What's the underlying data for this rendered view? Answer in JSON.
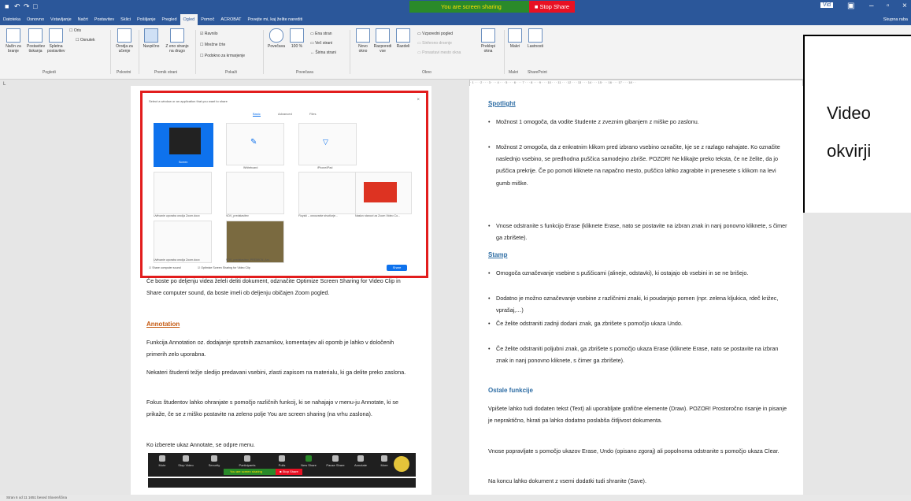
{
  "sharing": {
    "status": "You are screen sharing",
    "stop": "■ Stop Share"
  },
  "title": {
    "user": "Vid"
  },
  "tabs": [
    "Datoteka",
    "Osnovno",
    "Vstavljanje",
    "Načrt",
    "Postavitev",
    "Sklici",
    "Pošiljanje",
    "Pregled",
    "Ogled",
    "Pomoč",
    "ACROBAT",
    "Povejte mi, kaj želite narediti"
  ],
  "share_btn": "Skupna raba",
  "ribbon": {
    "buttons": [
      "Način za branje",
      "Postavitev tiskanja",
      "Spletna postavitev",
      "Orodja za učenje",
      "Navpično",
      "Z eno stranjo na drugo",
      "Povečava",
      "100 %",
      "Novo okno",
      "Razporedi vse",
      "Razdeli",
      "Preklopi okna",
      "Makri",
      "Lastnosti"
    ],
    "checks": [
      "Ravnilo",
      "Mrežne črte",
      "Podokno za krmarjenje",
      "Ena stran",
      "Več strani",
      "Širina strani",
      "Vzporedni pogled",
      "Sinhrono drsenje",
      "Ponastavi mesto okna",
      "Oris",
      "Osnutek"
    ],
    "groups": [
      "Pogledi",
      "Pokretni",
      "Premik strani",
      "Pokaži",
      "Povečava",
      "Okno",
      "Makri",
      "SharePoint"
    ]
  },
  "dialog": {
    "title": "Select a window or an application that you want to share",
    "tabs": [
      "Basic",
      "Advanced",
      "Files"
    ],
    "thumbs": [
      "Screen",
      "Whiteboard",
      "iPhone/iPad",
      "Uvfivanie uporaba orodja Zoom.docx",
      "VDV_predstavitev",
      "Fizyzki – osnovarke stvotlorje...",
      "Naslov stanovi za Zoom Video Co...",
      "Uvfivanie uporaba orodja Zoom.docx",
      "VDV_predstavitev_PREMICN_Aru..."
    ],
    "check1": "Share computer sound",
    "check2": "Optimize Screen Sharing for Video Clip",
    "share": "Share"
  },
  "page1": {
    "para1": "Če boste po deljenju videa želeli deliti dokument, odznačite Optimize Screen Sharing for Video Clip in Share computer sound, da boste imeli ob deljenju običajen Zoom pogled.",
    "h_annotation": "Annotation",
    "para2": "Funkcija Annotation oz. dodajanje sprotnih zaznamkov, komentarjev ali opomb je lahko v določenih primerih zelo uporabna.",
    "para3": "Nekateri študenti težje sledijo predavani vsebini, zlasti zapisom na materialu, ki ga delite preko zaslona.",
    "para4": "Fokus študentov lahko ohranjate s pomočjo različnih funkcij, ki se nahajajo v menu-ju Annotate, ki se prikaže, če se z miško postavite na zeleno polje You are screen sharing (na vrhu zaslona).",
    "para5": "Ko izberete ukaz Annotate, se odpre menu."
  },
  "zoombar": {
    "buttons": [
      "Mute",
      "Stop Video",
      "Security",
      "Participants",
      "Polls",
      "New Share",
      "Pause Share",
      "Annotate",
      "More"
    ],
    "sharing": "You are screen sharing",
    "stop": "■ Stop Share"
  },
  "page2": {
    "h_spotlight": "Spotlight",
    "b1": "Možnost 1 omogoča, da vodite študente z zveznim gibanjem z miške po zaslonu.",
    "b2": "Možnost 2 omogoča, da z enkratnim klikom pred izbrano vsebino označite, kje se z razlago nahajate. Ko označite naslednjo vsebino, se predhodna puščica samodejno zbriše. POZOR! Ne klikajte preko teksta, če ne želite, da jo puščica prekrije. Če po pomoti kliknete na napačno mesto, puščico lahko zagrabite in prenesete s klikom na levi gumb miške.",
    "b3": "Vnose odstranite s funkcijo Erase (kliknete Erase, nato se postavite na izbran znak in nanj ponovno kliknete, s čimer ga zbrišete).",
    "h_stamp": "Stamp",
    "b4": "Omogoča označevanje vsebine s puščicami (alineje, odstavki), ki ostajajo ob vsebini in se ne brišejo.",
    "b5": "Dodatno je možno označevanje vsebine z različnimi znaki, ki poudarjajo pomen (npr. zelena kljukica, rdeč križec, vprašaj,…)",
    "b6": "Če želite odstraniti zadnji dodani znak, ga zbrišete s pomočjo ukaza Undo.",
    "b7": "Če želite odstraniti poljubni znak, ga zbrišete s pomočjo ukaza Erase (kliknete Erase, nato se postavite na izbran znak in nanj ponovno kliknete, s čimer ga zbrišete).",
    "h_other": "Ostale funkcije",
    "p1": "Vpišete lahko tudi dodaten tekst (Text) ali uporabljate grafične elemente (Draw). POZOR! Prostoročno risanje in pisanje je nepraktično, hkrati pa lahko dodatno poslabša čitljivost dokumenta.",
    "p2": "Vnose popravljate s pomočjo ukazov Erase, Undo (opisano zgoraj) ali popolnoma odstranite s pomočjo ukaza Clear.",
    "p3": "Na koncu lahko dokument z vsemi dodatki tudi shranite (Save)."
  },
  "video": {
    "line1": "Video",
    "line2": "okvirji"
  },
  "status": {
    "text": "Stran 6 od 11   1651 besed   Slovenščina"
  }
}
